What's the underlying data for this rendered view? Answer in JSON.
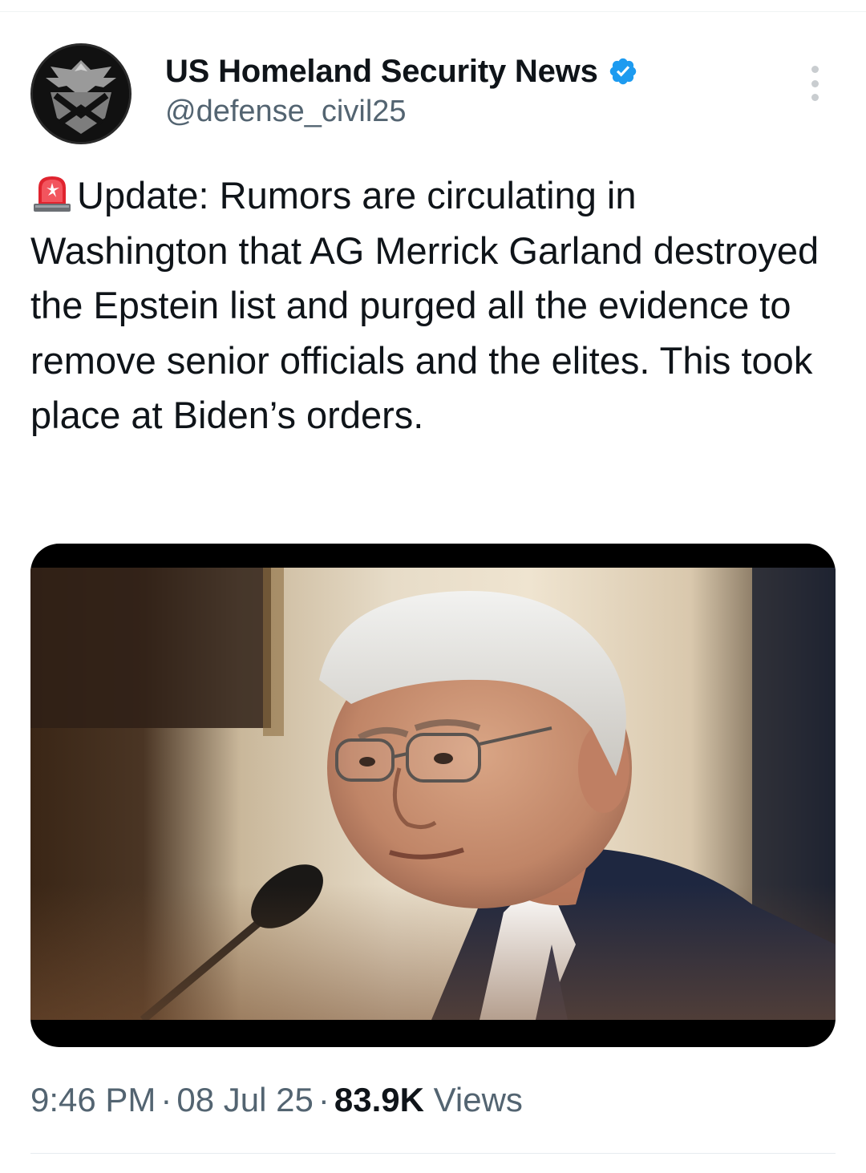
{
  "author": {
    "display_name": "US Homeland Security News",
    "handle": "@defense_civil25",
    "verified": true,
    "verified_color": "#1d9bf0",
    "avatar": "shield-eagle-logo"
  },
  "tweet": {
    "emoji": "rotating-light-siren",
    "text": "Update: Rumors are circulating in Washington that AG Merrick Garland destroyed the Epstein list and purged all the evidence to remove senior officials and the elites. This took place at Biden’s orders.",
    "media": {
      "kind": "photo",
      "subject": "man-with-glasses-at-microphone"
    }
  },
  "meta": {
    "time": "9:46 PM",
    "date": "08 Jul 25",
    "views_count": "83.9K",
    "views_label": "Views"
  },
  "icons": {
    "more": "more-vertical-icon",
    "verified": "verified-badge-icon"
  },
  "colors": {
    "text_primary": "#0f1419",
    "text_secondary": "#536471"
  }
}
